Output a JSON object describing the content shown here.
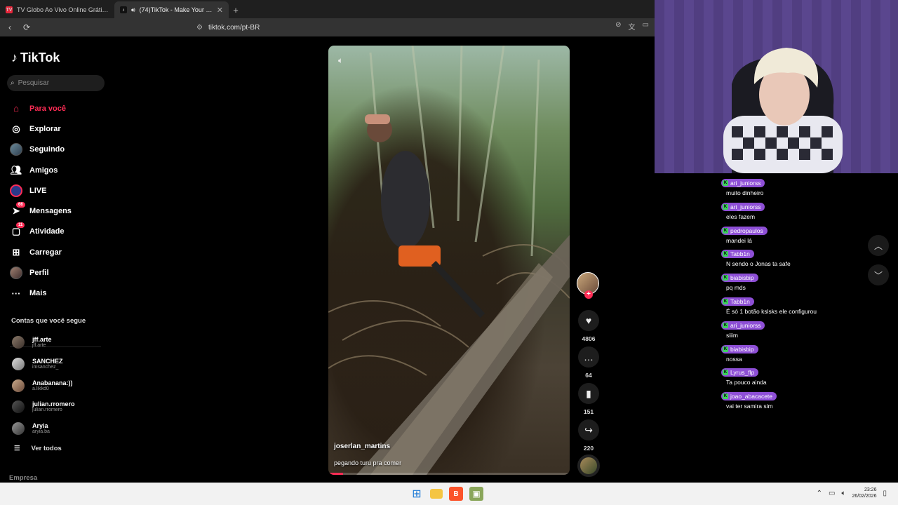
{
  "browser": {
    "tabs": [
      {
        "title": "TV Globo Ao Vivo Online Grátis | Ass",
        "favicon_color": "#e8263b",
        "active": false
      },
      {
        "title": "(74)TikTok - Make Your Day",
        "favicon_color": "#111111",
        "active": true
      }
    ],
    "url": "tiktok.com/pt-BR"
  },
  "tiktok": {
    "logo_text": "TikTok",
    "search_placeholder": "Pesquisar",
    "menu": [
      {
        "label": "Para você",
        "icon": "home-icon",
        "active": true
      },
      {
        "label": "Explorar",
        "icon": "compass-icon"
      },
      {
        "label": "Seguindo",
        "icon": "following-avatar"
      },
      {
        "label": "Amigos",
        "icon": "friends-icon"
      },
      {
        "label": "LIVE",
        "icon": "live-icon"
      },
      {
        "label": "Mensagens",
        "icon": "messages-icon",
        "badge": "66"
      },
      {
        "label": "Atividade",
        "icon": "activity-icon",
        "badge": "11"
      },
      {
        "label": "Carregar",
        "icon": "upload-icon"
      },
      {
        "label": "Perfil",
        "icon": "profile-avatar"
      },
      {
        "label": "Mais",
        "icon": "more-icon"
      }
    ],
    "following_title": "Contas que você segue",
    "following": [
      {
        "name": "jff.arte",
        "handle": "jff.arte"
      },
      {
        "name": "SANCHEZ",
        "handle": "imsanchez_"
      },
      {
        "name": "Anabanana:))",
        "handle": "a.likkd0"
      },
      {
        "name": "julian.rromero",
        "handle": "julian.rromero"
      },
      {
        "name": "Aryia",
        "handle": "aryia.ba"
      }
    ],
    "see_all": "Ver todos",
    "company": "Empresa",
    "video": {
      "username": "joserlan_martins",
      "caption": "pegando turu pra comer",
      "progress": 0.06
    },
    "actions": {
      "likes": "4806",
      "comments": "64",
      "saves": "151",
      "shares": "220"
    }
  },
  "chat": [
    {
      "user": "ari_juniorss",
      "text": "muito dinheiro"
    },
    {
      "user": "ari_juniorss",
      "text": "eles fazem"
    },
    {
      "user": "pedropaulos",
      "text": "mandei lá"
    },
    {
      "user": "Tabb1n",
      "text": "N sendo o Jonas ta safe"
    },
    {
      "user": "biabisbip",
      "text": "pq mds"
    },
    {
      "user": "Tabb1n",
      "text": "É só 1 botão kslsks ele configurou"
    },
    {
      "user": "ari_juniorss",
      "text": "siiim"
    },
    {
      "user": "biabisbip",
      "text": "nossa"
    },
    {
      "user": "Lyrus_flp",
      "text": "Ta pouco ainda"
    },
    {
      "user": "joao_abacacete",
      "text": "vai ter samira sim"
    }
  ],
  "taskbar": {
    "time": "23:26",
    "date": "26/02/2026"
  },
  "colors": {
    "accent": "#fe2c55",
    "chat_badge": "#8e4fd6"
  }
}
